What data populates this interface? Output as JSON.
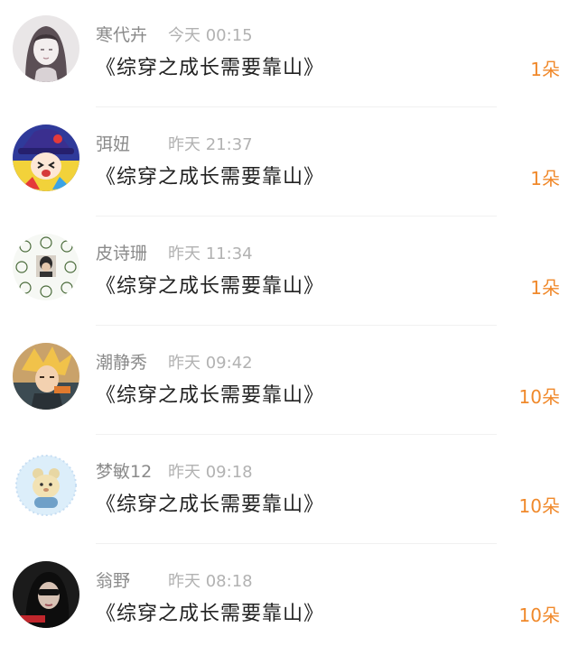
{
  "records": [
    {
      "name": "寒代卉",
      "time": "今天  00:15",
      "title": "《综穿之成长需要靠山》",
      "amount": "1朵",
      "avatar": "avatar-girl-sketch"
    },
    {
      "name": "弭妞",
      "time": "昨天  21:37",
      "title": "《综穿之成长需要靠山》",
      "amount": "1朵",
      "avatar": "avatar-cartoon-witch"
    },
    {
      "name": "皮诗珊",
      "time": "昨天  11:34",
      "title": "《综穿之成长需要靠山》",
      "amount": "1朵",
      "avatar": "avatar-meme-grid"
    },
    {
      "name": "潮静秀",
      "time": "昨天  09:42",
      "title": "《综穿之成长需要靠山》",
      "amount": "10朵",
      "avatar": "avatar-anime-boy"
    },
    {
      "name": "梦敏12",
      "time": "昨天  09:18",
      "title": "《综穿之成长需要靠山》",
      "amount": "10朵",
      "avatar": "avatar-cartoon-bear"
    },
    {
      "name": "翁野",
      "time": "昨天  08:18",
      "title": "《综穿之成长需要靠山》",
      "amount": "10朵",
      "avatar": "avatar-dark-portrait"
    }
  ],
  "colors": {
    "amount": "#f0892b",
    "name": "#8a8a8a",
    "time": "#b2b2b2",
    "title": "#222222"
  }
}
